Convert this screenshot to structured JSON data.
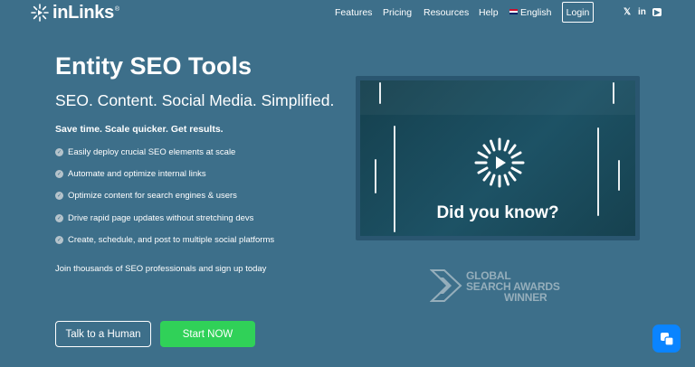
{
  "brand": {
    "name": "inLinks",
    "registered": "®"
  },
  "nav": {
    "links": [
      "Features",
      "Pricing",
      "Resources",
      "Help"
    ],
    "language": "English",
    "login": "Login"
  },
  "social": {
    "x": "𝕏",
    "linkedin": "in",
    "youtube": "▶"
  },
  "hero": {
    "title": "Entity SEO Tools",
    "subtitle": "SEO. Content. Social Media. Simplified.",
    "tagline": "Save time. Scale quicker. Get results.",
    "features": [
      "Easily deploy crucial SEO elements at scale",
      "Automate and optimize internal links",
      "Optimize content for search engines & users",
      "Drive rapid page updates without stretching devs",
      "Create, schedule, and post to multiple social platforms"
    ],
    "join": "Join thousands of SEO professionals and sign up today",
    "cta_human": "Talk to a Human",
    "cta_start": "Start NOW"
  },
  "video": {
    "caption": "Did you know?"
  },
  "award": {
    "line1": "GLOBAL",
    "line2": "SEARCH AWARDS",
    "line3": "WINNER"
  },
  "colors": {
    "background": "#3d6f8a",
    "cta_green": "#30d158",
    "chat_blue": "#0a84ff"
  }
}
